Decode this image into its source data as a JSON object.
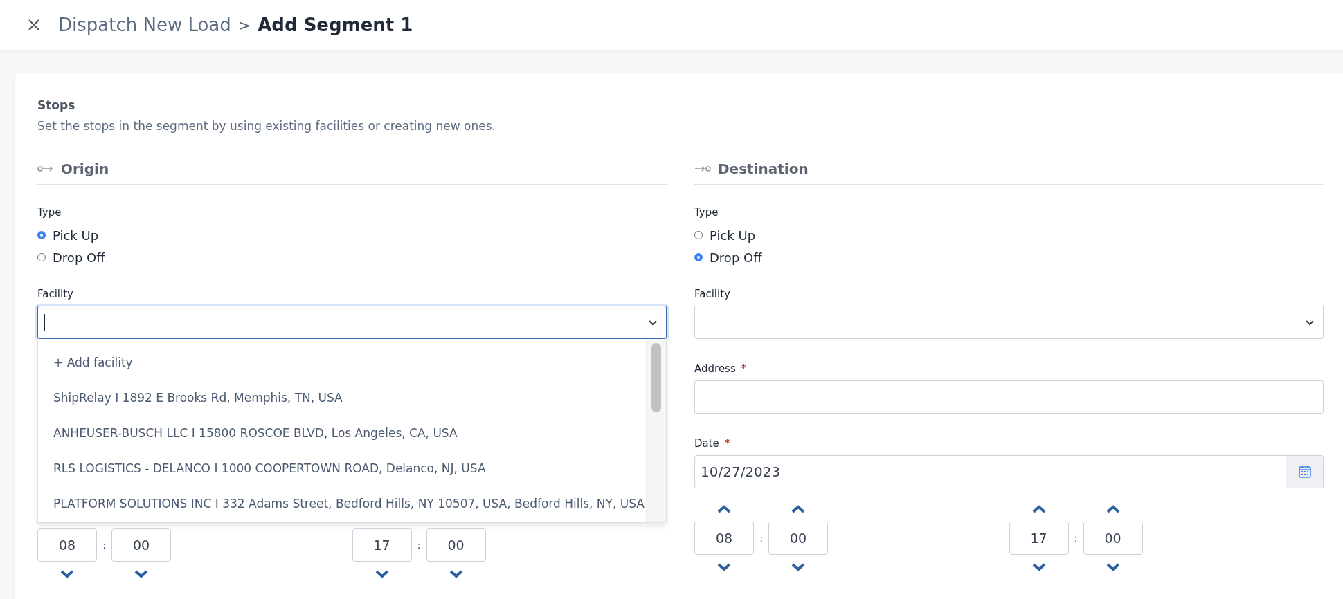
{
  "header": {
    "close_icon": true,
    "breadcrumb": "Dispatch New Load",
    "separator": ">",
    "title": "Add Segment 1"
  },
  "section": {
    "title": "Stops",
    "description": "Set the stops in the segment by using existing facilities or creating new ones."
  },
  "stops": [
    {
      "kind": "origin",
      "heading": "Origin",
      "type_label": "Type",
      "options": [
        {
          "label": "Pick Up",
          "selected": true
        },
        {
          "label": "Drop Off",
          "selected": false
        }
      ],
      "facility_label": "Facility",
      "facility_focused": true,
      "dropdown_items": [
        "+ Add facility",
        "ShipRelay I 1892 E Brooks Rd, Memphis, TN, USA",
        "ANHEUSER-BUSCH LLC I 15800 ROSCOE BLVD, Los Angeles, CA, USA",
        "RLS LOGISTICS - DELANCO I 1000 COOPERTOWN ROAD, Delanco, NJ, USA",
        "PLATFORM SOLUTIONS INC I 332 Adams Street, Bedford Hills, NY 10507, USA, Bedford Hills, NY, USA"
      ],
      "up_arrows_visible": false,
      "times": [
        {
          "hour": "08",
          "minute": "00",
          "sep": ":"
        },
        {
          "hour": "17",
          "minute": "00",
          "sep": ":"
        }
      ]
    },
    {
      "kind": "destination",
      "heading": "Destination",
      "type_label": "Type",
      "options": [
        {
          "label": "Pick Up",
          "selected": false
        },
        {
          "label": "Drop Off",
          "selected": true
        }
      ],
      "facility_label": "Facility",
      "facility_focused": false,
      "address_label": "Address",
      "address_required": "*",
      "date_label": "Date",
      "date_required": "*",
      "date_value": "10/27/2023",
      "up_arrows_visible": true,
      "times": [
        {
          "hour": "08",
          "minute": "00",
          "sep": ":"
        },
        {
          "hour": "17",
          "minute": "00",
          "sep": ":"
        }
      ]
    }
  ]
}
